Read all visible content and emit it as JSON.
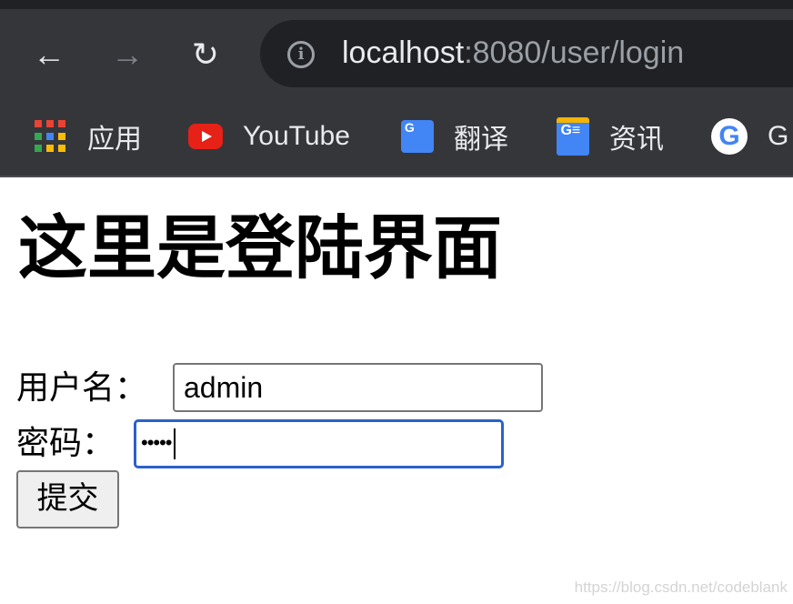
{
  "browser": {
    "url_host": "localhost",
    "url_rest": ":8080/user/login",
    "icons": {
      "back": "arrow-left-icon",
      "forward": "arrow-right-icon",
      "reload": "reload-icon",
      "info": "info-icon"
    },
    "bookmarks": [
      {
        "label": "应用",
        "icon": "apps-grid-icon"
      },
      {
        "label": "YouTube",
        "icon": "youtube-icon"
      },
      {
        "label": "翻译",
        "icon": "google-translate-icon"
      },
      {
        "label": "资讯",
        "icon": "google-news-icon"
      },
      {
        "label": "G",
        "icon": "google-icon"
      }
    ]
  },
  "page": {
    "title": "这里是登陆界面",
    "username_label": "用户名：",
    "username_value": "admin",
    "password_label": "密码：",
    "password_masked": "•••••",
    "submit_label": "提交",
    "focus_color": "#2a62c9"
  },
  "watermark": "https://blog.csdn.net/codeblank"
}
